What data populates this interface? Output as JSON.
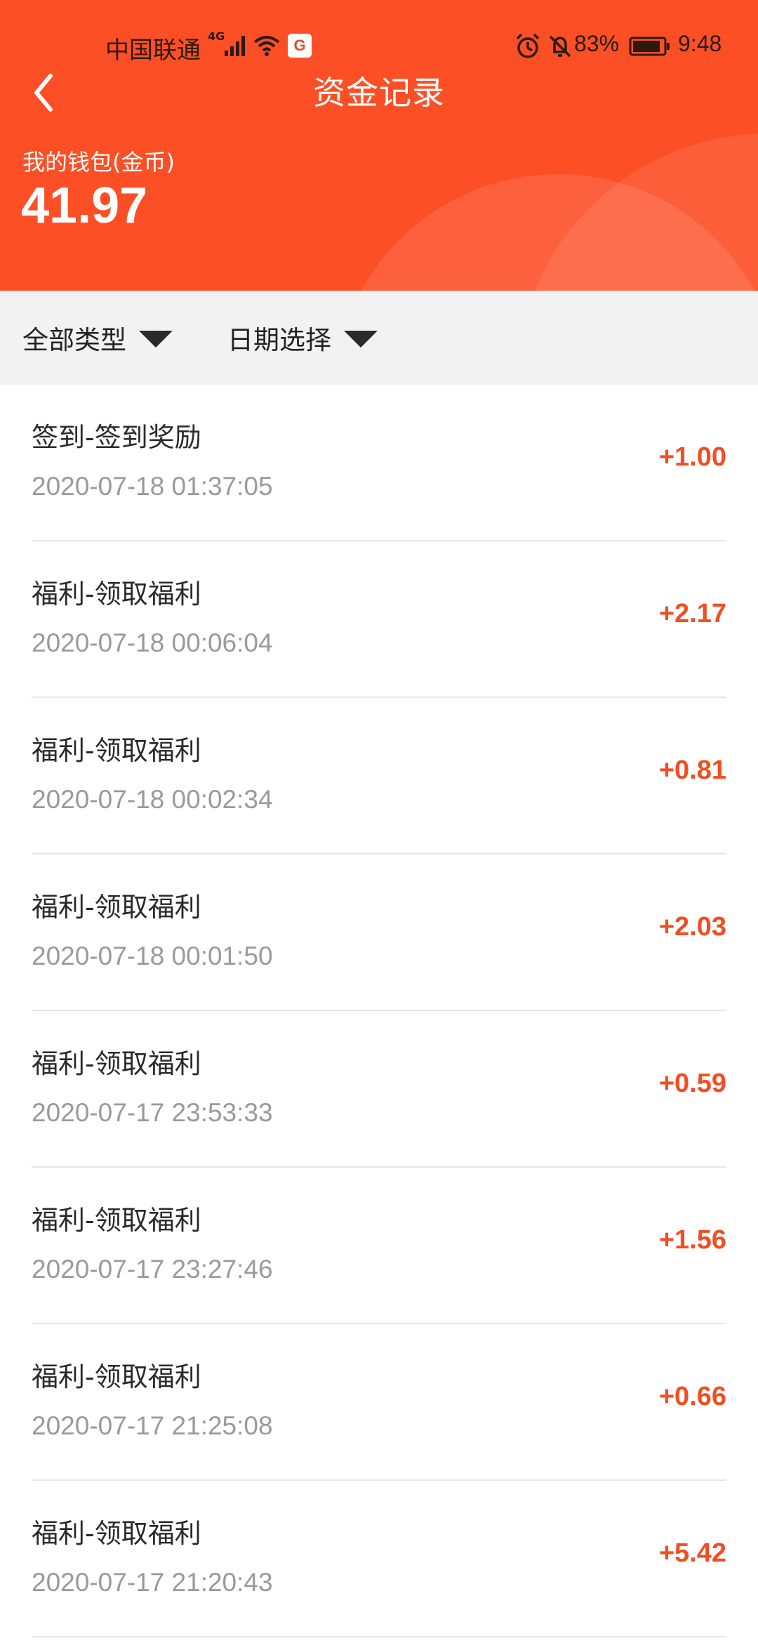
{
  "status_bar": {
    "carrier": "中国联通",
    "network_type": "4G",
    "app_notification_letter": "G",
    "battery": "83%",
    "time": "9:48",
    "icons": [
      "signal-icon",
      "wifi-icon",
      "app-notification-icon",
      "alarm-icon",
      "mute-icon",
      "battery-icon"
    ]
  },
  "header": {
    "title": "资金记录",
    "back_icon": "chevron-left-icon",
    "wallet_label": "我的钱包(金币)",
    "wallet_amount": "41.97",
    "accent_color": "#fc4f26"
  },
  "filters": [
    {
      "label": "全部类型",
      "icon": "triangle-down-icon"
    },
    {
      "label": "日期选择",
      "icon": "triangle-down-icon"
    }
  ],
  "records": [
    {
      "name": "签到-签到奖励",
      "time": "2020-07-18 01:37:05",
      "amount": "+1.00"
    },
    {
      "name": "福利-领取福利",
      "time": "2020-07-18 00:06:04",
      "amount": "+2.17"
    },
    {
      "name": "福利-领取福利",
      "time": "2020-07-18 00:02:34",
      "amount": "+0.81"
    },
    {
      "name": "福利-领取福利",
      "time": "2020-07-18 00:01:50",
      "amount": "+2.03"
    },
    {
      "name": "福利-领取福利",
      "time": "2020-07-17 23:53:33",
      "amount": "+0.59"
    },
    {
      "name": "福利-领取福利",
      "time": "2020-07-17 23:27:46",
      "amount": "+1.56"
    },
    {
      "name": "福利-领取福利",
      "time": "2020-07-17 21:25:08",
      "amount": "+0.66"
    },
    {
      "name": "福利-领取福利",
      "time": "2020-07-17 21:20:43",
      "amount": "+5.42"
    }
  ],
  "colors": {
    "amount": "#f04e23",
    "filter_bar": "#f2f2f2"
  }
}
